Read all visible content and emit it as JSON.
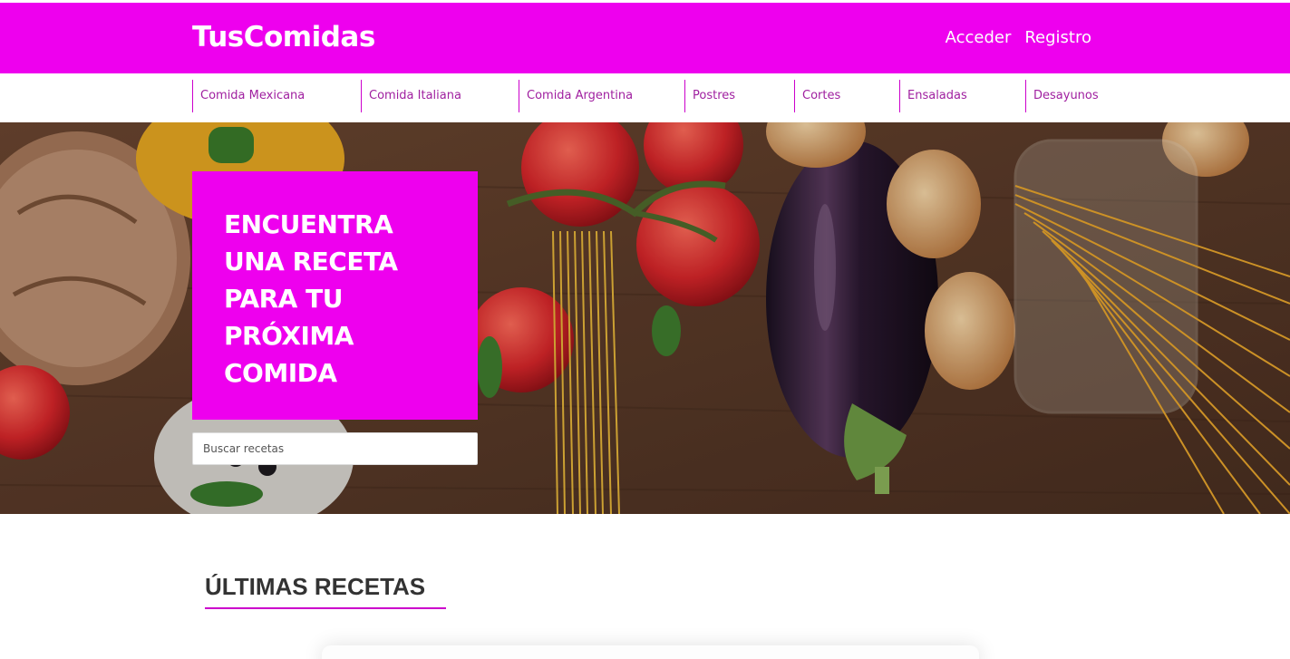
{
  "header": {
    "logo": "TusComidas",
    "links": [
      "Acceder",
      "Registro"
    ]
  },
  "categories": [
    "Comida Mexicana",
    "Comida Italiana",
    "Comida Argentina",
    "Postres",
    "Cortes",
    "Ensaladas",
    "Desayunos"
  ],
  "hero": {
    "title": "ENCUENTRA UNA RECETA PARA TU PRÓXIMA COMIDA",
    "search_placeholder": "Buscar recetas"
  },
  "latest": {
    "title": "ÚLTIMAS RECETAS"
  },
  "colors": {
    "brand": "#ee00ee",
    "accent_line": "#cc00cc"
  }
}
